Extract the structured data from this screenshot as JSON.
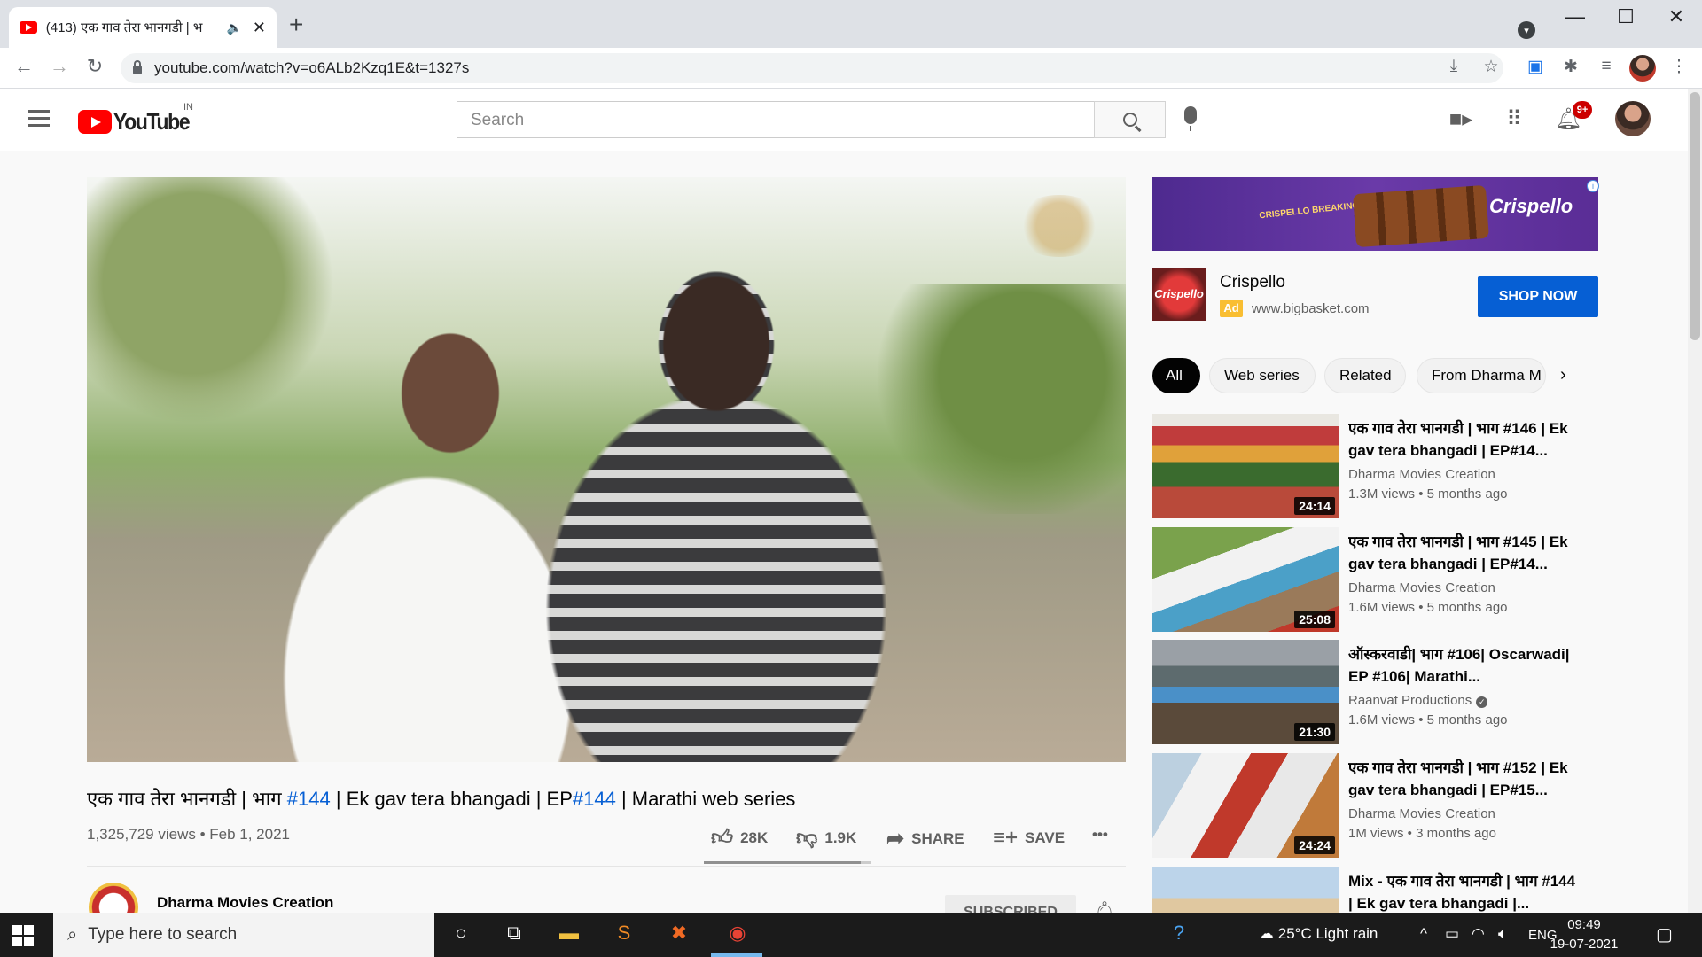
{
  "browser": {
    "tab_title": "(413) एक गाव तेरा भानगडी | भ",
    "tab_close": "✕",
    "new_tab": "+",
    "url": "youtube.com/watch?v=o6ALb2Kzq1E&t=1327s",
    "window_buttons": [
      "—",
      "☐",
      "✕"
    ]
  },
  "header": {
    "logo_text": "YouTube",
    "country": "IN",
    "search_placeholder": "Search",
    "notifications_badge": "9+"
  },
  "video": {
    "title_parts": {
      "p1": "एक गाव तेरा भानगडी | भाग ",
      "h1": "#144",
      "p2": " | Ek gav tera bhangadi | EP",
      "h2": "#144",
      "p3": " | Marathi web series"
    },
    "meta": "1,325,729 views • Feb 1, 2021",
    "likes": "28K",
    "like_ratio": 0.94,
    "dislikes": "1.9K",
    "share_label": "SHARE",
    "save_label": "SAVE",
    "more_label": "•••",
    "channel_name": "Dharma Movies Creation",
    "subscribe_label": "SUBSCRIBED"
  },
  "ad": {
    "banner_tagline": "CRISPELLO BREAKING EQUAL SHARING",
    "banner_brand": "Crispello",
    "logo_text": "Crispello",
    "name": "Crispello",
    "badge": "Ad",
    "url": "www.bigbasket.com",
    "cta": "SHOP NOW"
  },
  "chips": [
    "All",
    "Web series",
    "Related",
    "From Dharma M"
  ],
  "recommendations": [
    {
      "title": "एक गाव तेरा भानगडी | भाग #146 | Ek gav tera bhangadi | EP#14...",
      "channel": "Dharma Movies Creation",
      "meta": "1.3M views • 5 months ago",
      "duration": "24:14",
      "verified": false
    },
    {
      "title": "एक गाव तेरा भानगडी | भाग #145 | Ek gav tera bhangadi | EP#14...",
      "channel": "Dharma Movies Creation",
      "meta": "1.6M views • 5 months ago",
      "duration": "25:08",
      "verified": false
    },
    {
      "title": "ऑस्करवाडी| भाग #106| Oscarwadi| EP #106| Marathi...",
      "channel": "Raanvat Productions",
      "meta": "1.6M views • 5 months ago",
      "duration": "21:30",
      "verified": true
    },
    {
      "title": "एक गाव तेरा भानगडी | भाग #152 | Ek gav tera bhangadi | EP#15...",
      "channel": "Dharma Movies Creation",
      "meta": "1M views • 3 months ago",
      "duration": "24:24",
      "verified": false
    },
    {
      "title": "Mix - एक गाव तेरा भानगडी | भाग #144 | Ek gav tera bhangadi |...",
      "channel": "",
      "meta": "",
      "duration": "",
      "verified": false
    }
  ],
  "taskbar": {
    "search_placeholder": "Type here to search",
    "weather": "25°C  Light rain",
    "language": "ENG",
    "time": "09:49",
    "date": "19-07-2021"
  }
}
